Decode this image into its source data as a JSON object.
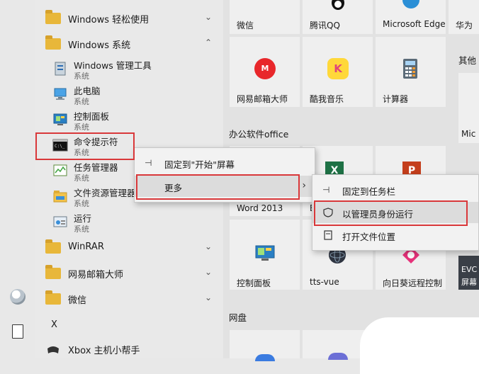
{
  "applist": {
    "items": [
      {
        "type": "folder",
        "label": "Windows 轻松使用",
        "chevron": "⌄"
      },
      {
        "type": "folder",
        "label": "Windows 系统",
        "chevron": "⌃"
      },
      {
        "type": "app",
        "label": "Windows 管理工具",
        "sub": "系统"
      },
      {
        "type": "app",
        "label": "此电脑",
        "sub": "系统"
      },
      {
        "type": "app",
        "label": "控制面板",
        "sub": "系统"
      },
      {
        "type": "app",
        "label": "命令提示符",
        "sub": "系统"
      },
      {
        "type": "app",
        "label": "任务管理器",
        "sub": "系统"
      },
      {
        "type": "app",
        "label": "文件资源管理器",
        "sub": "系统"
      },
      {
        "type": "app",
        "label": "运行",
        "sub": "系统"
      },
      {
        "type": "folder",
        "label": "WinRAR",
        "chevron": "⌄"
      },
      {
        "type": "folder",
        "label": "网易邮箱大师",
        "chevron": "⌄"
      },
      {
        "type": "folder",
        "label": "微信",
        "chevron": "⌄"
      },
      {
        "type": "letter",
        "label": "X"
      },
      {
        "type": "app",
        "label": "Xbox 主机小帮手"
      }
    ]
  },
  "tiles": {
    "row1": [
      "微信",
      "腾讯QQ",
      "Microsoft Edge",
      "华为"
    ],
    "row1_group_right": "其他",
    "row2": [
      "网易邮箱大师",
      "酷我音乐",
      "计算器"
    ],
    "row2_right": "Mic",
    "group_office": "办公软件office",
    "row3": [
      "Word 2013",
      "E"
    ],
    "row4": [
      "控制面板",
      "tts-vue",
      "向日葵远程控制"
    ],
    "row4_right": [
      "EVC",
      "屏幕"
    ],
    "group_netdisk": "网盘"
  },
  "context_menu": {
    "items": [
      {
        "label": "固定到\"开始\"屏幕",
        "icon": "pin-icon"
      },
      {
        "label": "更多",
        "icon": "",
        "arrow": "›"
      }
    ]
  },
  "submenu": {
    "items": [
      {
        "label": "固定到任务栏",
        "icon": "pin-icon"
      },
      {
        "label": "以管理员身份运行",
        "icon": "shield-icon"
      },
      {
        "label": "打开文件位置",
        "icon": "folder-doc-icon"
      }
    ]
  },
  "colors": {
    "highlight_border": "#d9383a",
    "accent": "#0078d7"
  }
}
